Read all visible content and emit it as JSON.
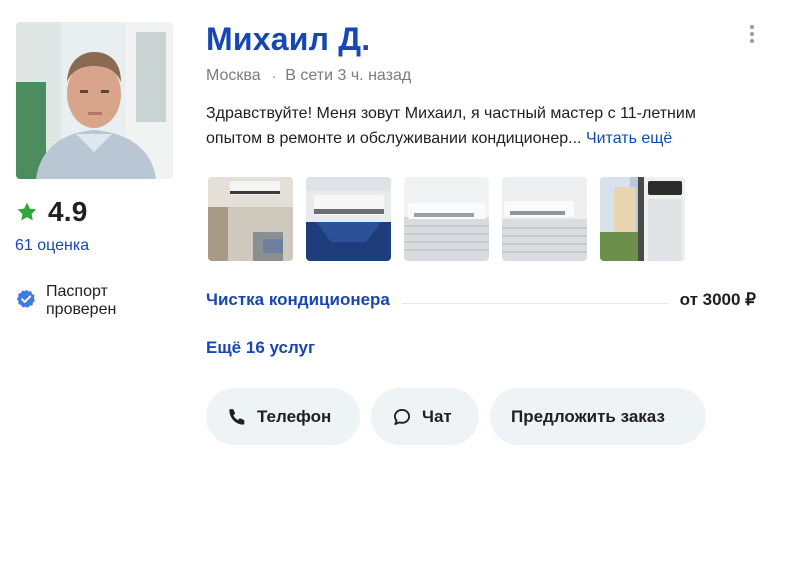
{
  "profile": {
    "name": "Михаил Д.",
    "city": "Москва",
    "separator": "·",
    "online_status": "В сети 3 ч. назад",
    "rating": "4.9",
    "reviews_link": "61 оценка",
    "passport_status": "Паспорт проверен",
    "description": "Здравствуйте! Меня зовут Михаил, я частный мастер с 11-летним опытом в ремонте и обслуживании кондиционер...",
    "read_more": "Читать ещё"
  },
  "photos": [
    {
      "icon": "photo-ac-balcony"
    },
    {
      "icon": "photo-ac-covered"
    },
    {
      "icon": "photo-ac-unit"
    },
    {
      "icon": "photo-ac-unit-2"
    },
    {
      "icon": "photo-ac-window"
    }
  ],
  "service": {
    "title": "Чистка кондиционера",
    "price": "от 3000 ₽"
  },
  "more_services": "Ещё 16 услуг",
  "actions": {
    "phone": "Телефон",
    "chat": "Чат",
    "offer": "Предложить заказ"
  },
  "colors": {
    "link": "#1747b4",
    "star": "#2ea83a",
    "verified": "#3f7be0",
    "button_bg": "#eef3f6",
    "muted": "#7e7b78"
  }
}
